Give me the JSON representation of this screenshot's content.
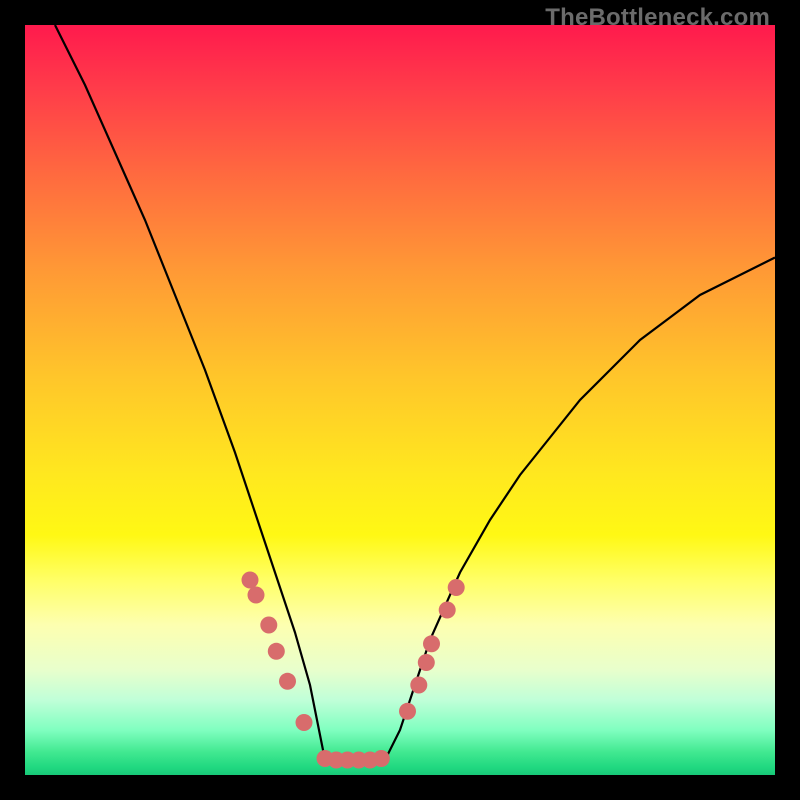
{
  "attribution": "TheBottleneck.com",
  "colors": {
    "gradient_top": "#ff1a4d",
    "gradient_bottom": "#18c878",
    "curve": "#000000",
    "points": "#d86c6c",
    "frame_bg": "#000000"
  },
  "chart_data": {
    "type": "line",
    "title": "",
    "xlabel": "",
    "ylabel": "",
    "xlim": [
      0,
      100
    ],
    "ylim": [
      0,
      100
    ],
    "grid": false,
    "curve": {
      "comment": "V-shaped bottleneck curve; y=0 is the bottom (green) edge, y=100 the top (red) edge. Flat optimum floor between x≈40 and x≈48.",
      "x": [
        4,
        8,
        12,
        16,
        20,
        24,
        28,
        30,
        32,
        34,
        36,
        38,
        40,
        42,
        44,
        46,
        48,
        50,
        52,
        54,
        58,
        62,
        66,
        70,
        74,
        78,
        82,
        86,
        90,
        94,
        98,
        100
      ],
      "y": [
        100,
        92,
        83,
        74,
        64,
        54,
        43,
        37,
        31,
        25,
        19,
        12,
        2,
        2,
        2,
        2,
        2,
        6,
        12,
        18,
        27,
        34,
        40,
        45,
        50,
        54,
        58,
        61,
        64,
        66,
        68,
        69
      ]
    },
    "points": [
      {
        "x": 30.0,
        "y": 26.0
      },
      {
        "x": 30.8,
        "y": 24.0
      },
      {
        "x": 32.5,
        "y": 20.0
      },
      {
        "x": 33.5,
        "y": 16.5
      },
      {
        "x": 35.0,
        "y": 12.5
      },
      {
        "x": 37.2,
        "y": 7.0
      },
      {
        "x": 40.0,
        "y": 2.2
      },
      {
        "x": 41.5,
        "y": 2.0
      },
      {
        "x": 43.0,
        "y": 2.0
      },
      {
        "x": 44.5,
        "y": 2.0
      },
      {
        "x": 46.0,
        "y": 2.0
      },
      {
        "x": 47.5,
        "y": 2.2
      },
      {
        "x": 51.0,
        "y": 8.5
      },
      {
        "x": 52.5,
        "y": 12.0
      },
      {
        "x": 53.5,
        "y": 15.0
      },
      {
        "x": 54.2,
        "y": 17.5
      },
      {
        "x": 56.3,
        "y": 22.0
      },
      {
        "x": 57.5,
        "y": 25.0
      }
    ]
  }
}
